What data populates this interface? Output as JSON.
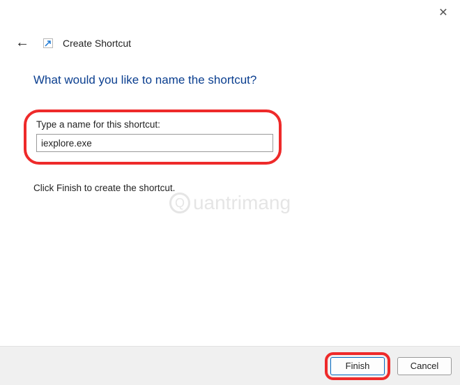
{
  "window": {
    "close_symbol": "✕"
  },
  "header": {
    "back_symbol": "←",
    "title": "Create Shortcut"
  },
  "content": {
    "heading": "What would you like to name the shortcut?",
    "input_label": "Type a name for this shortcut:",
    "input_value": "iexplore.exe",
    "instruction": "Click Finish to create the shortcut."
  },
  "watermark": {
    "text": "uantrimang"
  },
  "buttons": {
    "finish": "Finish",
    "cancel": "Cancel"
  }
}
